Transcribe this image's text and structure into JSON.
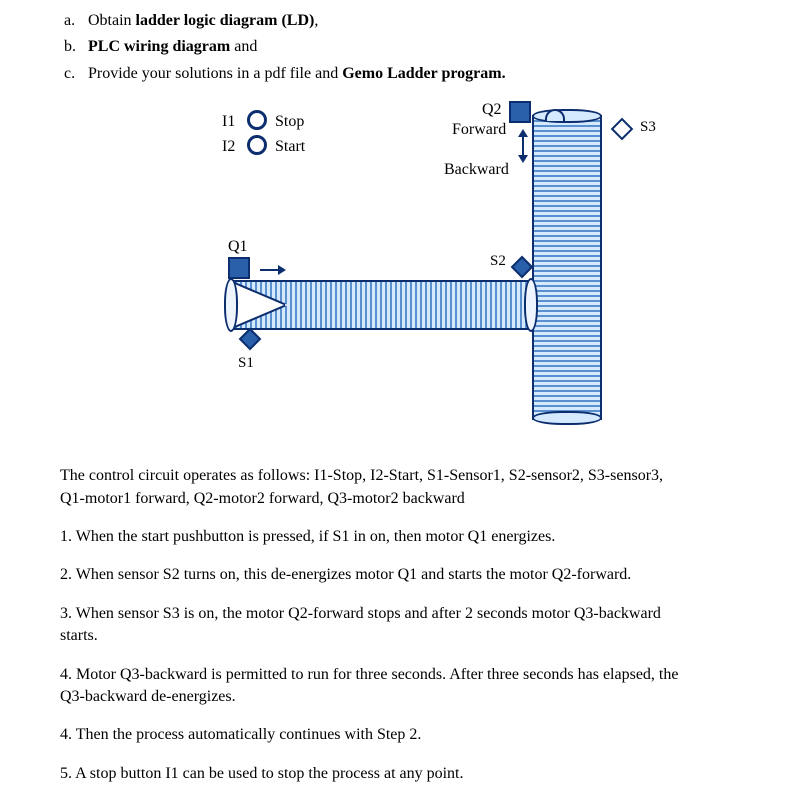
{
  "list": {
    "a": {
      "marker": "a.",
      "pre": "Obtain ",
      "bold": "ladder logic diagram (LD)",
      "post": ","
    },
    "b": {
      "marker": "b.",
      "bold": "PLC wiring diagram",
      "post": " and"
    },
    "c": {
      "marker": "c.",
      "pre": "Provide your solutions in a pdf file and ",
      "bold": "Gemo Ladder program."
    }
  },
  "diagram": {
    "i1": "I1",
    "i2": "I2",
    "stop": "Stop",
    "start": "Start",
    "q1": "Q1",
    "q2": "Q2",
    "forward": "Forward",
    "backward": "Backward",
    "s1": "S1",
    "s2": "S2",
    "s3": "S3"
  },
  "desc": {
    "line1": "The control circuit operates as follows: I1-Stop, I2-Start, S1-Sensor1, S2-sensor2, S3-sensor3,",
    "line2": "Q1-motor1 forward, Q2-motor2 forward, Q3-motor2 backward"
  },
  "steps": {
    "s1": "1. When the start pushbutton is pressed, if S1 in on, then motor Q1 energizes.",
    "s2": "2. When sensor S2 turns on, this de-energizes motor Q1 and starts the motor Q2-forward.",
    "s3a": "3. When sensor S3 is on, the motor Q2-forward stops and after 2 seconds motor Q3-backward",
    "s3b": "starts.",
    "s4a": "4. Motor Q3-backward is permitted to run for three seconds. After three seconds has elapsed, the",
    "s4b": "Q3-backward de-energizes.",
    "s5": "4. Then the process automatically continues with Step 2.",
    "s6": "5. A stop button I1 can be used to stop the process at any point."
  }
}
